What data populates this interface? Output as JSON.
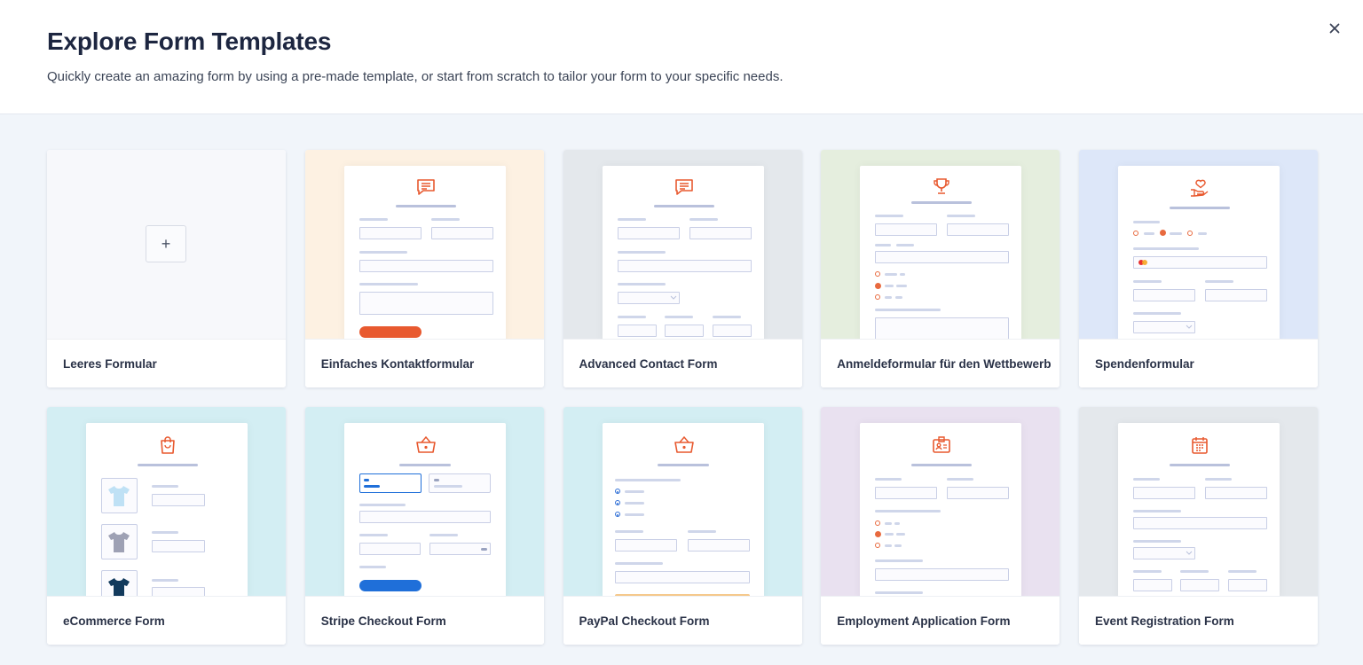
{
  "header": {
    "title": "Explore Form Templates",
    "subtitle": "Quickly create an amazing form by using a pre-made template, or start from scratch to tailor your form to your specific needs."
  },
  "plus_symbol": "+",
  "colors": {
    "accent": "#e8592f",
    "blue_accent": "#1f6fd9",
    "bg_peach": "#fdf1e2",
    "bg_gray": "#e4e8ec",
    "bg_green": "#e5eede",
    "bg_blue": "#dde7f9",
    "bg_cyan": "#d3eef3",
    "bg_lilac": "#e9e1f0"
  },
  "templates": [
    {
      "label": "Leeres Formular",
      "icon": "plus-icon"
    },
    {
      "label": "Einfaches Kontaktformular",
      "icon": "message-icon"
    },
    {
      "label": "Advanced Contact Form",
      "icon": "message-icon"
    },
    {
      "label": "Anmeldeformular für den Wettbewerb",
      "icon": "trophy-icon"
    },
    {
      "label": "Spendenformular",
      "icon": "donation-heart-icon"
    },
    {
      "label": "eCommerce Form",
      "icon": "shopping-bag-icon"
    },
    {
      "label": "Stripe Checkout Form",
      "icon": "basket-icon"
    },
    {
      "label": "PayPal Checkout Form",
      "icon": "basket-icon"
    },
    {
      "label": "Employment Application Form",
      "icon": "id-badge-icon"
    },
    {
      "label": "Event Registration Form",
      "icon": "calendar-icon"
    }
  ]
}
